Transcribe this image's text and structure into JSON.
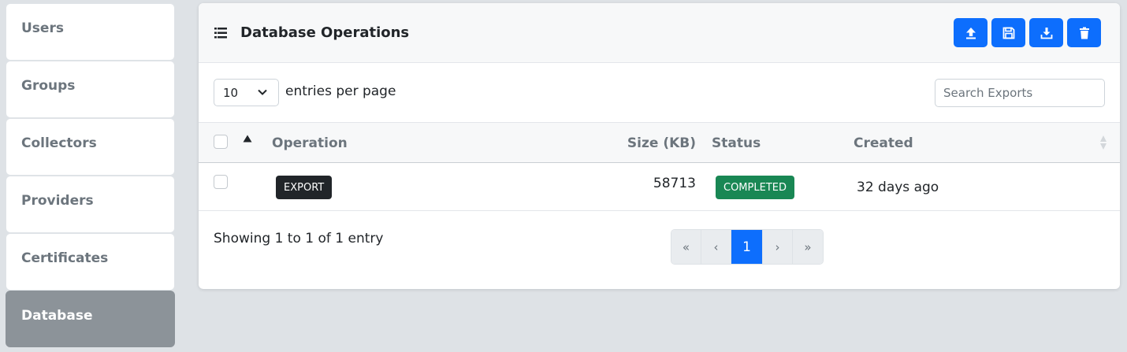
{
  "sidebar": {
    "items": [
      {
        "label": "Users"
      },
      {
        "label": "Groups"
      },
      {
        "label": "Collectors"
      },
      {
        "label": "Providers"
      },
      {
        "label": "Certificates"
      },
      {
        "label": "Database",
        "active": true
      }
    ]
  },
  "card": {
    "title": "Database Operations",
    "icon": "list-icon",
    "toolbar": [
      {
        "icon": "upload-icon"
      },
      {
        "icon": "save-icon"
      },
      {
        "icon": "download-icon"
      },
      {
        "icon": "trash-icon"
      }
    ]
  },
  "controls": {
    "page_size": "10",
    "entries_label": "entries per page",
    "search_placeholder": "Search Exports"
  },
  "table": {
    "columns": [
      "Operation",
      "Size (KB)",
      "Status",
      "Created"
    ],
    "rows": [
      {
        "operation": "EXPORT",
        "size_kb": "58713",
        "status": "COMPLETED",
        "created": "32 days ago"
      }
    ]
  },
  "footer": {
    "showing": "Showing 1 to 1 of 1 entry",
    "pagination": {
      "first": "«",
      "prev": "‹",
      "current": "1",
      "next": "›",
      "last": "»"
    }
  },
  "colors": {
    "primary": "#0d6efd",
    "success": "#198754",
    "dark": "#212529",
    "sidebar_active": "#8c9399"
  }
}
